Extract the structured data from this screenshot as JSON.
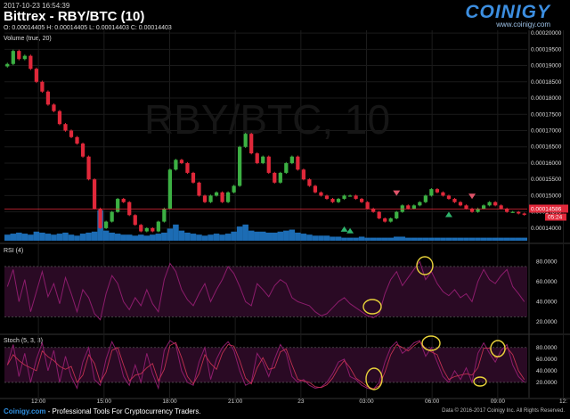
{
  "header": {
    "timestamp": "2017-10-23 16:54:39",
    "title": "Bittrex - RBY/BTC (10)",
    "ohlc": "O: 0.00014405 H: 0.00014405 L: 0.00014403 C: 0.00014403",
    "volume_label": "Volume (true, 20)"
  },
  "logo": {
    "word": "COINIGY",
    "url": "www.coinigy.com"
  },
  "watermark": "RBY/BTC, 10",
  "panes": {
    "rsi_label": "RSI (4)",
    "stoch_label": "Stoch (5, 3, 3)"
  },
  "footer": {
    "brand": "Coinigy.com",
    "tagline": " - Professional Tools For Cryptocurrency Traders.",
    "copyright": "Data © 2016-2017 Coinigy Inc. All Rights Reserved."
  },
  "colors": {
    "up": "#3cb043",
    "down": "#e0283a",
    "volume": "#1f78c8",
    "oscillator": "#8c1c6c",
    "annotation": "#e8d23a"
  },
  "chart_data": [
    {
      "type": "line",
      "series": [
        {
          "values": [
            0.0001905,
            0.0001945,
            0.000192,
            0.000193,
            0.000189,
            0.000185,
            0.000182,
            0.000178,
            0.000176,
            0.000172,
            0.00017,
            0.000168,
            0.000166,
            0.000162,
            0.000155,
            0.000146,
            0.00014,
            0.000142,
            0.000145,
            0.000149,
            0.000148,
            0.000144,
            0.000141,
            0.000139,
            0.00014,
            0.000139,
            0.000142,
            0.000146,
            0.000158,
            0.000161,
            0.00016,
            0.000157,
            0.000154,
            0.00015,
            0.000148,
            0.00015,
            0.000151,
            0.000148,
            0.000151,
            0.000153,
            0.000165,
            0.000169,
            0.000163,
            0.00016,
            0.000162,
            0.000157,
            0.000154,
            0.000157,
            0.00016,
            0.000162,
            0.000158,
            0.000155,
            0.000153,
            0.000151,
            0.00015,
            0.000149,
            0.000148,
            0.000149,
            0.00015,
            0.00015,
            0.000149,
            0.000148,
            0.000146,
            0.000145,
            0.000143,
            0.000142,
            0.000143,
            0.000145,
            0.000147,
            0.000146,
            0.000147,
            0.000148,
            0.00015,
            0.000152,
            0.000151,
            0.00015,
            0.000149,
            0.000148,
            0.000147,
            0.000146,
            0.000145,
            0.000146,
            0.000147,
            0.000148,
            0.000147,
            0.000146,
            0.000145,
            0.000145,
            0.0001445,
            0.0001441
          ]
        }
      ],
      "x_ticks": [
        "12:00",
        "15:00",
        "18:00",
        "21:00",
        "23",
        "03:00",
        "06:00",
        "09:00",
        "12:"
      ],
      "y_ticks": [
        "0.00020000",
        "0.00019500",
        "0.00019000",
        "0.00018500",
        "0.00018000",
        "0.00017500",
        "0.00017000",
        "0.00016500",
        "0.00016000",
        "0.00015500",
        "0.00015000",
        "0.00014500",
        "0.00014000"
      ],
      "ylim": [
        0.0001375,
        0.0002003
      ],
      "last_price_label": "0.00014586",
      "timer_label": "05:24",
      "volume": [
        6,
        7,
        8,
        7,
        6,
        9,
        8,
        7,
        6,
        7,
        8,
        6,
        5,
        7,
        8,
        9,
        30,
        10,
        8,
        7,
        6,
        6,
        5,
        6,
        5,
        6,
        7,
        8,
        12,
        16,
        10,
        8,
        7,
        6,
        5,
        6,
        7,
        6,
        7,
        9,
        14,
        16,
        10,
        9,
        9,
        8,
        8,
        9,
        10,
        11,
        8,
        7,
        6,
        5,
        5,
        5,
        4,
        4,
        3,
        3,
        3,
        4,
        3,
        3,
        3,
        3,
        3,
        4,
        4,
        3,
        3,
        3,
        3,
        3,
        3,
        3,
        3,
        3,
        3,
        3,
        3,
        3,
        3,
        3,
        3,
        3,
        3,
        3,
        3,
        3
      ]
    },
    {
      "type": "line",
      "title": "RSI (4)",
      "y_ticks": [
        "80.0000",
        "60.0000",
        "40.0000",
        "20.0000"
      ],
      "ylim": [
        12,
        90
      ],
      "series": [
        {
          "values": [
            55,
            72,
            40,
            62,
            30,
            50,
            70,
            45,
            58,
            38,
            64,
            48,
            30,
            52,
            44,
            28,
            22,
            48,
            66,
            58,
            40,
            32,
            44,
            36,
            52,
            38,
            30,
            62,
            78,
            70,
            52,
            42,
            36,
            48,
            58,
            40,
            52,
            62,
            75,
            68,
            55,
            40,
            36,
            58,
            52,
            45,
            56,
            62,
            58,
            44,
            40,
            38,
            36,
            30,
            26,
            28,
            34,
            40,
            44,
            38,
            34,
            30,
            26,
            24,
            28,
            48,
            62,
            70,
            56,
            64,
            72,
            80,
            62,
            70,
            58,
            50,
            46,
            52,
            44,
            48,
            40,
            60,
            72,
            62,
            58,
            66,
            72,
            55,
            48,
            40
          ]
        }
      ]
    },
    {
      "type": "line",
      "title": "Stoch (5, 3, 3)",
      "y_ticks": [
        "80.0000",
        "60.0000",
        "40.0000",
        "20.0000"
      ],
      "ylim": [
        0,
        95
      ],
      "series": [
        {
          "values": [
            50,
            85,
            30,
            70,
            20,
            60,
            88,
            40,
            75,
            20,
            65,
            30,
            10,
            55,
            80,
            25,
            15,
            60,
            90,
            70,
            30,
            15,
            50,
            20,
            70,
            35,
            10,
            75,
            92,
            85,
            40,
            20,
            15,
            55,
            80,
            25,
            60,
            80,
            90,
            75,
            40,
            15,
            20,
            70,
            55,
            30,
            60,
            85,
            70,
            30,
            20,
            25,
            15,
            10,
            12,
            20,
            35,
            55,
            60,
            30,
            25,
            15,
            10,
            8,
            20,
            55,
            80,
            90,
            70,
            78,
            88,
            92,
            65,
            80,
            55,
            30,
            20,
            40,
            25,
            45,
            20,
            70,
            88,
            70,
            55,
            75,
            85,
            50,
            30,
            20
          ]
        }
      ]
    }
  ]
}
